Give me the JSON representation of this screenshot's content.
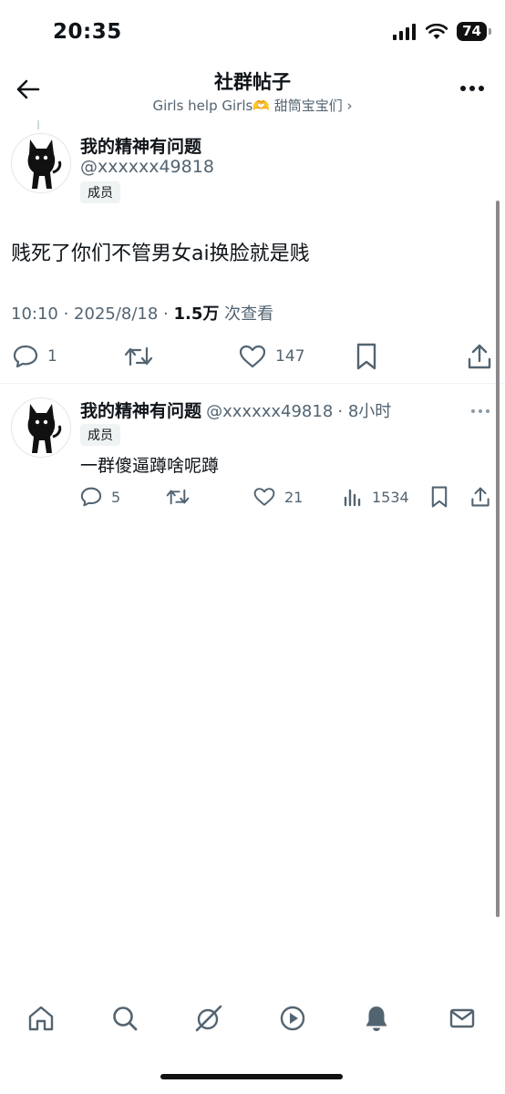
{
  "status_bar": {
    "time": "20:35",
    "battery": "74"
  },
  "header": {
    "title": "社群帖子",
    "subtitle": "Girls help Girls🫶 甜筒宝宝们 ›"
  },
  "post": {
    "display_name": "我的精神有问题",
    "handle": "@xxxxxx49818",
    "badge": "成员",
    "text": "贱死了你们不管男女ai换脸就是贱",
    "meta_time": "10:10 · 2025/8/18 · ",
    "meta_views_count": "1.5万",
    "meta_views_label": " 次查看",
    "stats": {
      "replies": "1",
      "likes": "147"
    }
  },
  "reply": {
    "display_name": "我的精神有问题",
    "handle": "@xxxxxx49818",
    "time": "· 8小时",
    "badge": "成员",
    "text": "一群傻逼蹲啥呢蹲",
    "stats": {
      "replies": "5",
      "likes": "21",
      "views": "1534"
    }
  },
  "tabbar": {
    "icons": [
      "home-icon",
      "search-icon",
      "grok-icon",
      "video-icon",
      "notifications-icon",
      "messages-icon"
    ]
  },
  "colors": {
    "text": "#0f1419",
    "secondary": "#536471",
    "divider": "#eff3f4"
  }
}
